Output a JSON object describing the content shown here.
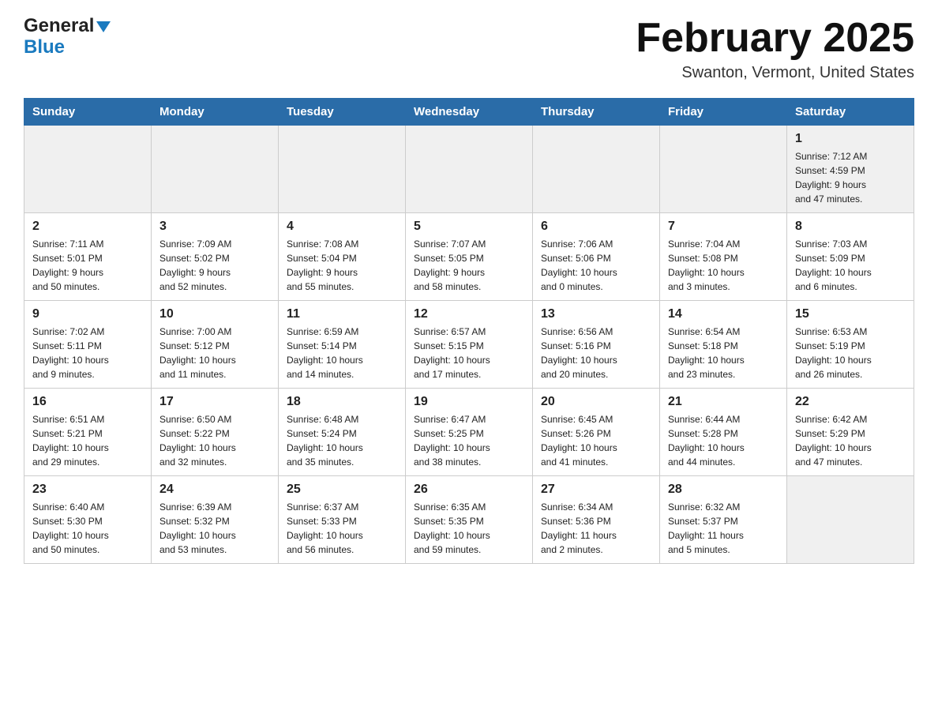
{
  "logo": {
    "general": "General",
    "blue": "Blue",
    "triangle": "▲"
  },
  "title": "February 2025",
  "subtitle": "Swanton, Vermont, United States",
  "days_header": [
    "Sunday",
    "Monday",
    "Tuesday",
    "Wednesday",
    "Thursday",
    "Friday",
    "Saturday"
  ],
  "weeks": [
    [
      {
        "num": "",
        "info": ""
      },
      {
        "num": "",
        "info": ""
      },
      {
        "num": "",
        "info": ""
      },
      {
        "num": "",
        "info": ""
      },
      {
        "num": "",
        "info": ""
      },
      {
        "num": "",
        "info": ""
      },
      {
        "num": "1",
        "info": "Sunrise: 7:12 AM\nSunset: 4:59 PM\nDaylight: 9 hours\nand 47 minutes."
      }
    ],
    [
      {
        "num": "2",
        "info": "Sunrise: 7:11 AM\nSunset: 5:01 PM\nDaylight: 9 hours\nand 50 minutes."
      },
      {
        "num": "3",
        "info": "Sunrise: 7:09 AM\nSunset: 5:02 PM\nDaylight: 9 hours\nand 52 minutes."
      },
      {
        "num": "4",
        "info": "Sunrise: 7:08 AM\nSunset: 5:04 PM\nDaylight: 9 hours\nand 55 minutes."
      },
      {
        "num": "5",
        "info": "Sunrise: 7:07 AM\nSunset: 5:05 PM\nDaylight: 9 hours\nand 58 minutes."
      },
      {
        "num": "6",
        "info": "Sunrise: 7:06 AM\nSunset: 5:06 PM\nDaylight: 10 hours\nand 0 minutes."
      },
      {
        "num": "7",
        "info": "Sunrise: 7:04 AM\nSunset: 5:08 PM\nDaylight: 10 hours\nand 3 minutes."
      },
      {
        "num": "8",
        "info": "Sunrise: 7:03 AM\nSunset: 5:09 PM\nDaylight: 10 hours\nand 6 minutes."
      }
    ],
    [
      {
        "num": "9",
        "info": "Sunrise: 7:02 AM\nSunset: 5:11 PM\nDaylight: 10 hours\nand 9 minutes."
      },
      {
        "num": "10",
        "info": "Sunrise: 7:00 AM\nSunset: 5:12 PM\nDaylight: 10 hours\nand 11 minutes."
      },
      {
        "num": "11",
        "info": "Sunrise: 6:59 AM\nSunset: 5:14 PM\nDaylight: 10 hours\nand 14 minutes."
      },
      {
        "num": "12",
        "info": "Sunrise: 6:57 AM\nSunset: 5:15 PM\nDaylight: 10 hours\nand 17 minutes."
      },
      {
        "num": "13",
        "info": "Sunrise: 6:56 AM\nSunset: 5:16 PM\nDaylight: 10 hours\nand 20 minutes."
      },
      {
        "num": "14",
        "info": "Sunrise: 6:54 AM\nSunset: 5:18 PM\nDaylight: 10 hours\nand 23 minutes."
      },
      {
        "num": "15",
        "info": "Sunrise: 6:53 AM\nSunset: 5:19 PM\nDaylight: 10 hours\nand 26 minutes."
      }
    ],
    [
      {
        "num": "16",
        "info": "Sunrise: 6:51 AM\nSunset: 5:21 PM\nDaylight: 10 hours\nand 29 minutes."
      },
      {
        "num": "17",
        "info": "Sunrise: 6:50 AM\nSunset: 5:22 PM\nDaylight: 10 hours\nand 32 minutes."
      },
      {
        "num": "18",
        "info": "Sunrise: 6:48 AM\nSunset: 5:24 PM\nDaylight: 10 hours\nand 35 minutes."
      },
      {
        "num": "19",
        "info": "Sunrise: 6:47 AM\nSunset: 5:25 PM\nDaylight: 10 hours\nand 38 minutes."
      },
      {
        "num": "20",
        "info": "Sunrise: 6:45 AM\nSunset: 5:26 PM\nDaylight: 10 hours\nand 41 minutes."
      },
      {
        "num": "21",
        "info": "Sunrise: 6:44 AM\nSunset: 5:28 PM\nDaylight: 10 hours\nand 44 minutes."
      },
      {
        "num": "22",
        "info": "Sunrise: 6:42 AM\nSunset: 5:29 PM\nDaylight: 10 hours\nand 47 minutes."
      }
    ],
    [
      {
        "num": "23",
        "info": "Sunrise: 6:40 AM\nSunset: 5:30 PM\nDaylight: 10 hours\nand 50 minutes."
      },
      {
        "num": "24",
        "info": "Sunrise: 6:39 AM\nSunset: 5:32 PM\nDaylight: 10 hours\nand 53 minutes."
      },
      {
        "num": "25",
        "info": "Sunrise: 6:37 AM\nSunset: 5:33 PM\nDaylight: 10 hours\nand 56 minutes."
      },
      {
        "num": "26",
        "info": "Sunrise: 6:35 AM\nSunset: 5:35 PM\nDaylight: 10 hours\nand 59 minutes."
      },
      {
        "num": "27",
        "info": "Sunrise: 6:34 AM\nSunset: 5:36 PM\nDaylight: 11 hours\nand 2 minutes."
      },
      {
        "num": "28",
        "info": "Sunrise: 6:32 AM\nSunset: 5:37 PM\nDaylight: 11 hours\nand 5 minutes."
      },
      {
        "num": "",
        "info": ""
      }
    ]
  ]
}
